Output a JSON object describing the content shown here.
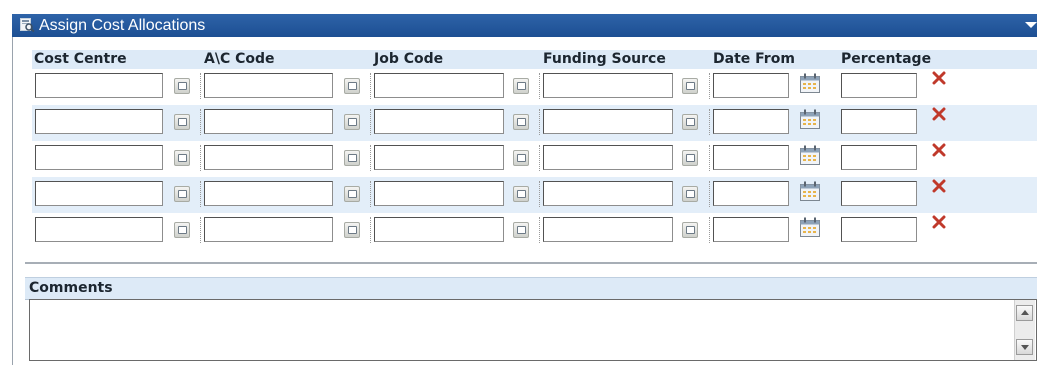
{
  "panel": {
    "title": "Assign Cost Allocations"
  },
  "columns": {
    "cost_centre": "Cost Centre",
    "ac_code": "A\\C Code",
    "job_code": "Job Code",
    "funding_source": "Funding Source",
    "date_from": "Date From",
    "percentage": "Percentage"
  },
  "rows": [
    {
      "cost_centre": "",
      "ac_code": "",
      "job_code": "",
      "funding_source": "",
      "date_from": "",
      "percentage": ""
    },
    {
      "cost_centre": "",
      "ac_code": "",
      "job_code": "",
      "funding_source": "",
      "date_from": "",
      "percentage": ""
    },
    {
      "cost_centre": "",
      "ac_code": "",
      "job_code": "",
      "funding_source": "",
      "date_from": "",
      "percentage": ""
    },
    {
      "cost_centre": "",
      "ac_code": "",
      "job_code": "",
      "funding_source": "",
      "date_from": "",
      "percentage": ""
    },
    {
      "cost_centre": "",
      "ac_code": "",
      "job_code": "",
      "funding_source": "",
      "date_from": "",
      "percentage": ""
    }
  ],
  "comments": {
    "label": "Comments",
    "value": ""
  },
  "icons": {
    "lookup": "lookup-icon",
    "calendar": "calendar-icon",
    "delete": "delete-row-icon",
    "collapse": "chevron-down-icon"
  },
  "colors": {
    "titlebar": "#2466ad",
    "header_bg": "#ddeaf7",
    "alt_row": "#e3eef9",
    "delete_red": "#c0392b"
  }
}
